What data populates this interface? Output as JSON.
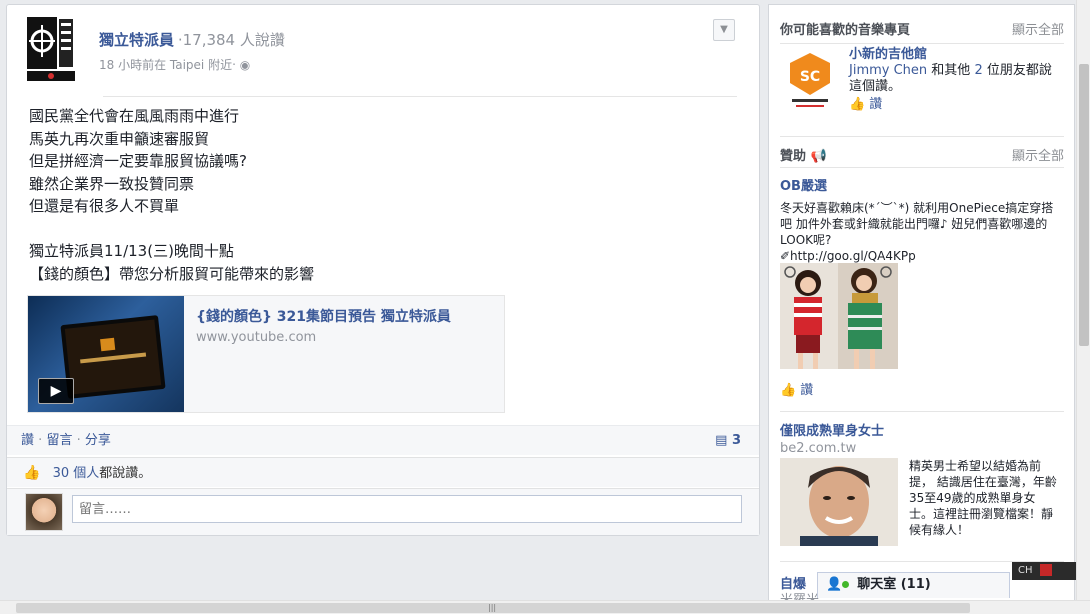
{
  "post": {
    "page_name": "獨立特派員",
    "likes_text": "‧17,384 人說讚",
    "time": "18 小時前在 Taipei 附近‧",
    "body_lines": [
      "國民黨全代會在風風雨雨中進行",
      "馬英九再次重申籲速審服貿",
      "但是拼經濟一定要靠服貿協議嗎?",
      "雖然企業界一致投贊同票",
      "但還是有很多人不買單",
      "",
      "獨立特派員11/13(三)晚間十點",
      "【錢的顏色】帶您分析服貿可能帶來的影響"
    ],
    "share": {
      "title": "{錢的顏色} 321集節目預告 獨立特派員",
      "domain": "www.youtube.com"
    },
    "actions": {
      "like": "讚",
      "comment": "留言",
      "share": "分享",
      "comments_count": "3"
    },
    "likes_summary": {
      "count": "30 個人",
      "suffix": "都說讚。"
    },
    "comment_placeholder": "留言……"
  },
  "sidebar": {
    "music_section": {
      "title": "你可能喜歡的音樂專頁",
      "see_all": "顯示全部",
      "page_name": "小新的吉他館",
      "friend_name": "Jimmy Chen",
      "friends_text": "和其他",
      "friends_count": "2",
      "friends_suffix": "位朋友都說這個讚。",
      "like_label": "讚"
    },
    "sponsored": {
      "title": "贊助",
      "see_all": "顯示全部"
    },
    "ad1": {
      "title": "OB嚴選",
      "body": "冬天好喜歡賴床(*´︶`*) 就利用OnePiece搞定穿搭吧 加件外套或針織就能出門囉♪ 妞兒們喜歡哪邊的LOOK呢?",
      "link": "✐http://goo.gl/QA4KPp",
      "like_label": "讚"
    },
    "ad2": {
      "title": "僅限成熟單身女士",
      "domain": "be2.com.tw",
      "body": "精英男士希望以結婚為前提， 結識居住在臺灣，年齡35至49歲的成熟單身女士。這裡註冊瀏覽檔案！靜候有緣人！"
    },
    "ad3": {
      "title": "自爆",
      "sub": "米羅米"
    }
  },
  "chat": {
    "label": "聊天室 (11)"
  },
  "ime": {
    "label": "CH"
  }
}
